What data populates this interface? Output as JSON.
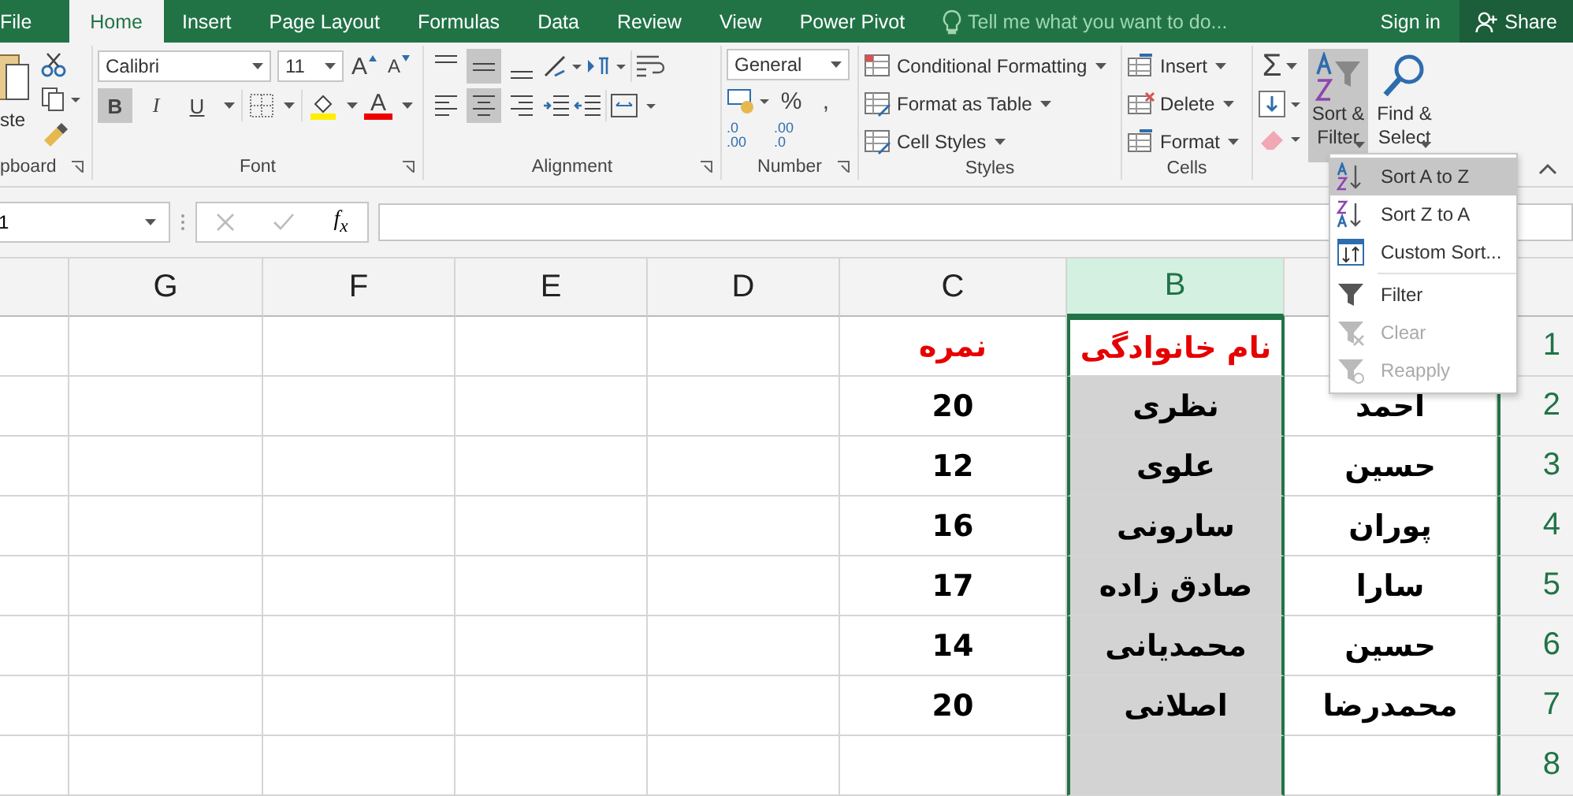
{
  "tabs": [
    {
      "label": "File",
      "selected": false
    },
    {
      "label": "Home",
      "selected": true
    },
    {
      "label": "Insert",
      "selected": false
    },
    {
      "label": "Page Layout",
      "selected": false
    },
    {
      "label": "Formulas",
      "selected": false
    },
    {
      "label": "Data",
      "selected": false
    },
    {
      "label": "Review",
      "selected": false
    },
    {
      "label": "View",
      "selected": false
    },
    {
      "label": "Power Pivot",
      "selected": false
    }
  ],
  "tell_me": {
    "placeholder": "Tell me what you want to do..."
  },
  "sign_in": "Sign in",
  "share": "Share",
  "clipboard": {
    "paste": "ste",
    "label": "pboard"
  },
  "font": {
    "name": "Calibri",
    "size": "11",
    "grow": "A",
    "shrink": "A",
    "styles": [
      {
        "label": "B",
        "selected": true
      },
      {
        "label": "I",
        "selected": false
      },
      {
        "label": "U",
        "selected": false
      }
    ],
    "color_letter": "A",
    "label": "Font"
  },
  "alignment": {
    "vertical": [
      {
        "kind": "top",
        "selected": false
      },
      {
        "kind": "middle",
        "selected": true
      },
      {
        "kind": "bottom",
        "selected": false
      }
    ],
    "horizontal": [
      {
        "kind": "left",
        "selected": false
      },
      {
        "kind": "center",
        "selected": true
      },
      {
        "kind": "right",
        "selected": false
      }
    ],
    "label": "Alignment"
  },
  "number": {
    "format": "General",
    "percent": "%",
    "comma": ",",
    "decimals": [
      {
        "top": ".0",
        "bottom": ".00"
      },
      {
        "top": ".00",
        "bottom": ".0"
      }
    ],
    "label": "Number"
  },
  "styles": {
    "items": [
      "Conditional Formatting",
      "Format as Table",
      "Cell Styles"
    ],
    "label": "Styles"
  },
  "cells": {
    "items": [
      "Insert",
      "Delete",
      "Format"
    ],
    "label": "Cells"
  },
  "editing": {
    "sum": "Σ",
    "sort_filter": [
      "Sort &",
      "Filter"
    ],
    "sort_filter_open": true,
    "find_select": [
      "Find &",
      "Select"
    ]
  },
  "sort_menu": [
    {
      "kind": "az",
      "label": "Sort A to Z",
      "selected": true,
      "disabled": false
    },
    {
      "kind": "za",
      "label": "Sort Z to A",
      "selected": false,
      "disabled": false
    },
    {
      "kind": "custom",
      "label": "Custom Sort...",
      "selected": false,
      "disabled": false
    },
    {
      "kind": "filter",
      "label": "Filter",
      "selected": false,
      "disabled": false
    },
    {
      "kind": "clear",
      "label": "Clear",
      "selected": false,
      "disabled": true
    },
    {
      "kind": "reapply",
      "label": "Reapply",
      "selected": false,
      "disabled": true
    }
  ],
  "formula_bar": {
    "name_box": "1",
    "fx": "f$_{x}$"
  },
  "columns": [
    {
      "selected": false
    },
    {
      "label": "G",
      "selected": false
    },
    {
      "label": "F",
      "selected": false
    },
    {
      "label": "E",
      "selected": false
    },
    {
      "label": "D",
      "selected": false
    },
    {
      "label": "C",
      "selected": false
    },
    {
      "label": "B",
      "selected": true
    },
    {
      "selected": false
    }
  ],
  "rows": [
    {
      "number": "1",
      "kind": "header",
      "cells": [
        null,
        "نام خانوادگی",
        "نمره"
      ]
    },
    {
      "number": "2",
      "kind": "data",
      "cells": [
        "احمد",
        "نظری",
        "20"
      ]
    },
    {
      "number": "3",
      "kind": "data",
      "cells": [
        "حسین",
        "علوی",
        "12"
      ]
    },
    {
      "number": "4",
      "kind": "data",
      "cells": [
        "پوران",
        "سارونی",
        "16"
      ]
    },
    {
      "number": "5",
      "kind": "data",
      "cells": [
        "سارا",
        "صادق زاده",
        "17"
      ]
    },
    {
      "number": "6",
      "kind": "data",
      "cells": [
        "حسین",
        "محمدیانی",
        "14"
      ]
    },
    {
      "number": "7",
      "kind": "data",
      "cells": [
        "محمدرضا",
        "اصلانی",
        "20"
      ]
    },
    {
      "number": "8",
      "kind": "data",
      "cells": []
    }
  ]
}
